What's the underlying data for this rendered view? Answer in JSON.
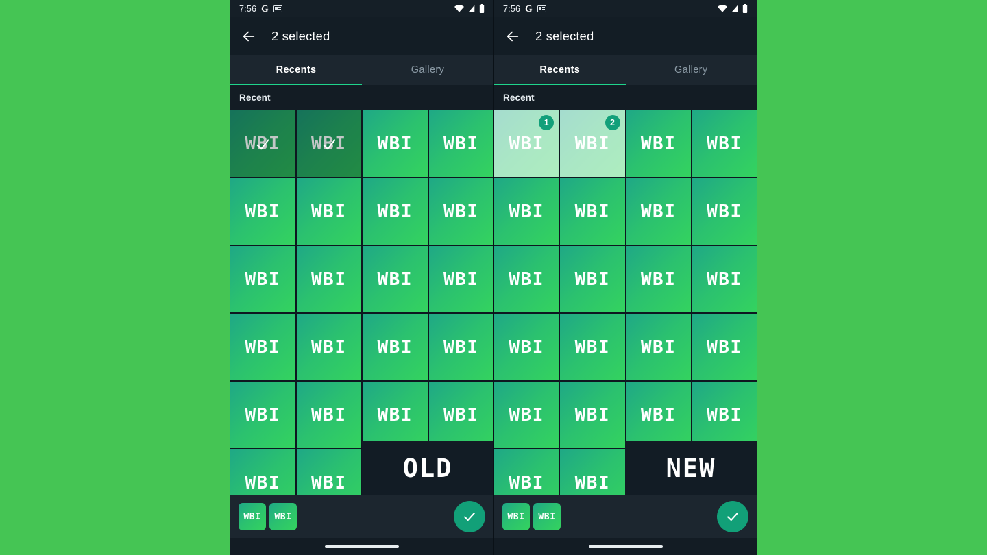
{
  "background_color": "#45C554",
  "theme": {
    "accent_teal": "#12A078",
    "accent_green": "#1FD48C",
    "tile_gradient_start": "#1FA886",
    "tile_gradient_end": "#34D35F",
    "appbar_bg": "#131D25",
    "tabbar_bg": "#1C262F",
    "section_bg": "#131C24"
  },
  "panels": [
    {
      "id": "old",
      "annotation": "OLD",
      "statusbar": {
        "time": "7:56",
        "google_icon": "G",
        "screenshot_icon": "screenshot-icon",
        "wifi_icon": "wifi-icon",
        "signal_icon": "signal-icon",
        "battery_icon": "battery-icon"
      },
      "appbar": {
        "back_icon": "back-arrow-icon",
        "title": "2 selected"
      },
      "tabs": [
        {
          "label": "Recents",
          "active": true
        },
        {
          "label": "Gallery",
          "active": false
        }
      ],
      "section_header": "Recent",
      "grid": {
        "columns": 4,
        "rows": 6,
        "tile_label": "WBI",
        "selection_style": "checkmark",
        "selected_indices": [
          0,
          1
        ],
        "checkmark_icon": "check-icon"
      },
      "bottombar": {
        "thumbnails": [
          {
            "label": "WBI"
          },
          {
            "label": "WBI"
          }
        ],
        "confirm_icon": "check-icon"
      },
      "navbar": {
        "pill": "home-gesture-pill"
      }
    },
    {
      "id": "new",
      "annotation": "NEW",
      "statusbar": {
        "time": "7:56",
        "google_icon": "G",
        "screenshot_icon": "screenshot-icon",
        "wifi_icon": "wifi-icon",
        "signal_icon": "signal-icon",
        "battery_icon": "battery-icon"
      },
      "appbar": {
        "back_icon": "back-arrow-icon",
        "title": "2 selected"
      },
      "tabs": [
        {
          "label": "Recents",
          "active": true
        },
        {
          "label": "Gallery",
          "active": false
        }
      ],
      "section_header": "Recent",
      "grid": {
        "columns": 4,
        "rows": 6,
        "tile_label": "WBI",
        "selection_style": "numbered-badge",
        "selected_indices": [
          0,
          1
        ],
        "badges": [
          "1",
          "2"
        ]
      },
      "bottombar": {
        "thumbnails": [
          {
            "label": "WBI"
          },
          {
            "label": "WBI"
          }
        ],
        "confirm_icon": "check-icon"
      },
      "navbar": {
        "pill": "home-gesture-pill"
      }
    }
  ]
}
